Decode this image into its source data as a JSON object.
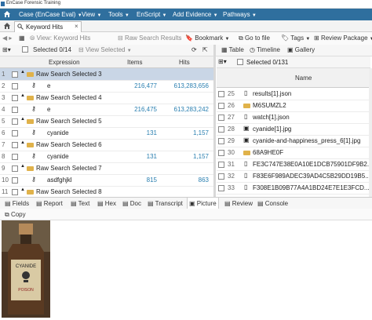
{
  "app": {
    "title": "EnCase Forensic Training"
  },
  "menu": {
    "home_icon": "home-icon",
    "items": [
      "Case (EnCase Eval)",
      "View",
      "Tools",
      "EnScript",
      "Add Evidence",
      "Pathways"
    ]
  },
  "tabs": {
    "active_label": "Keyword Hits"
  },
  "toolbar": {
    "view_keyword_hits": "View: Keyword Hits",
    "raw_search_results": "Raw Search Results",
    "bookmark": "Bookmark",
    "goto_file": "Go to file",
    "tags": "Tags",
    "review_package": "Review Package"
  },
  "left": {
    "selected": "Selected 0/14",
    "view_selected": "View Selected",
    "columns": [
      "Expression",
      "Items",
      "Hits"
    ],
    "rows": [
      {
        "n": "1",
        "expr": "Raw Search Selected 3",
        "items": "",
        "hits": "",
        "type": "folder",
        "selected": true
      },
      {
        "n": "2",
        "expr": "e",
        "items": "216,477",
        "hits": "613,283,656",
        "type": "key"
      },
      {
        "n": "3",
        "expr": "Raw Search Selected 4",
        "items": "",
        "hits": "",
        "type": "folder"
      },
      {
        "n": "4",
        "expr": "e",
        "items": "216,475",
        "hits": "613,283,242",
        "type": "key"
      },
      {
        "n": "5",
        "expr": "Raw Search Selected 5",
        "items": "",
        "hits": "",
        "type": "folder"
      },
      {
        "n": "6",
        "expr": "cyanide",
        "items": "131",
        "hits": "1,157",
        "type": "key"
      },
      {
        "n": "7",
        "expr": "Raw Search Selected 6",
        "items": "",
        "hits": "",
        "type": "folder"
      },
      {
        "n": "8",
        "expr": "cyanide",
        "items": "131",
        "hits": "1,157",
        "type": "key"
      },
      {
        "n": "9",
        "expr": "Raw Search Selected 7",
        "items": "",
        "hits": "",
        "type": "folder"
      },
      {
        "n": "10",
        "expr": "asdfghjkl",
        "items": "815",
        "hits": "863",
        "type": "key"
      },
      {
        "n": "11",
        "expr": "Raw Search Selected 8",
        "items": "",
        "hits": "",
        "type": "folder"
      }
    ]
  },
  "right": {
    "view_tabs": [
      "Table",
      "Timeline",
      "Gallery"
    ],
    "selected": "Selected 0/131",
    "name_header": "Name",
    "rows": [
      {
        "n": "25",
        "name": "results[1].json",
        "type": "file"
      },
      {
        "n": "26",
        "name": "M6SUMZL2",
        "type": "folder"
      },
      {
        "n": "27",
        "name": "watch[1].json",
        "type": "file"
      },
      {
        "n": "28",
        "name": "cyanide[1].jpg",
        "type": "image"
      },
      {
        "n": "29",
        "name": "cyanide-and-happiness_press_6[1].jpg",
        "type": "image"
      },
      {
        "n": "30",
        "name": "68A9HE0F",
        "type": "folder"
      },
      {
        "n": "31",
        "name": "FE3C747E38E0A10E1DCB75901DF9B2...",
        "type": "file"
      },
      {
        "n": "32",
        "name": "F83E6F989ADEC39AD4C5B29DD19B5...",
        "type": "file"
      },
      {
        "n": "33",
        "name": "F308E1B09B77A4A1BD24E7E1E3FCD...",
        "type": "file"
      }
    ]
  },
  "bottom": {
    "tabs": [
      "Fields",
      "Report",
      "Text",
      "Hex",
      "Doc",
      "Transcript",
      "Picture",
      "Review",
      "Console"
    ],
    "active": "Picture",
    "copy": "Copy"
  },
  "image": {
    "label_top": "CYANIDE",
    "label_bottom": "POISON"
  },
  "colors": {
    "menu_bar": "#2f6f9e",
    "selected_row": "#c9d6e6",
    "number": "#2a7fb0",
    "folder": "#e0b24a"
  }
}
